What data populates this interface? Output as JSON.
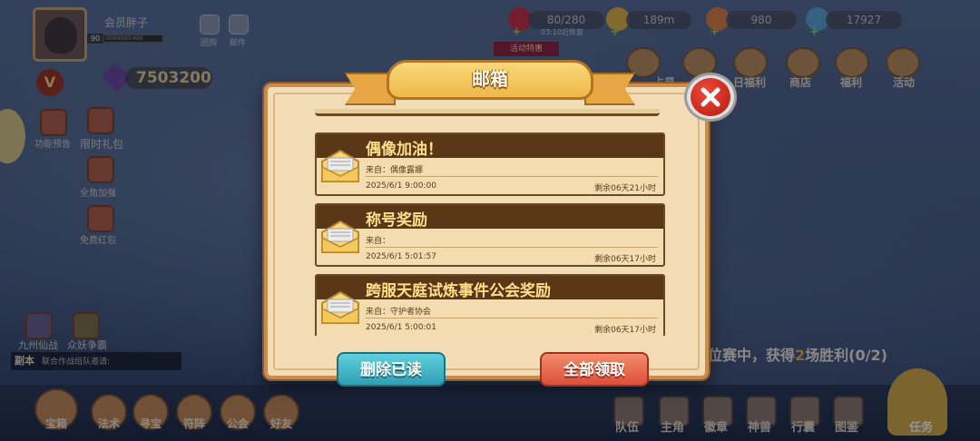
{
  "player": {
    "name": "会员胖子",
    "level": "90",
    "exp": "00000/01400"
  },
  "top_left_icons": [
    {
      "label": "团购"
    },
    {
      "label": "邮件"
    }
  ],
  "vip_badge": "V",
  "diamonds": "7503200",
  "resources": {
    "stamina": "80/280",
    "stamina_timer": "03:10后恢复",
    "gold": "189m",
    "gems": "980",
    "tickets": "17927"
  },
  "top_menu": [
    "占星",
    "神",
    "日福利",
    "商店",
    "福利",
    "活动"
  ],
  "top_menu_banner": "活动特惠",
  "left_menu": [
    {
      "label": "功能预告"
    },
    {
      "label": "限时礼包"
    },
    {
      "label": "全角加强"
    },
    {
      "label": "免费红包"
    }
  ],
  "bottom_left_events": [
    "九州仙战",
    "众妖争霸"
  ],
  "chat": {
    "channel": "副本",
    "text": "联合作战组队邀请:"
  },
  "quest_text_prefix": "位赛中，获得",
  "quest_text_highlight": "2",
  "quest_text_suffix": "场胜利(0/2)",
  "bottom_left_nav": [
    "宝箱",
    "法术",
    "寻宝",
    "符阵",
    "公会",
    "好友"
  ],
  "bottom_right_nav": [
    "队伍",
    "主角",
    "徽章",
    "神兽",
    "行囊",
    "图鉴"
  ],
  "task_label": "任务",
  "mailbox": {
    "title": "邮箱",
    "mails": [
      {
        "title": "偶像加油！",
        "sender": "来自：偶像露娜",
        "date": "2025/6/1 9:00:00",
        "remaining": "剩余06天21小时"
      },
      {
        "title": "称号奖励",
        "sender": "来自：",
        "date": "2025/6/1 5:01:57",
        "remaining": "剩余06天17小时"
      },
      {
        "title": "跨服天庭试炼事件公会奖励",
        "sender": "来自：守护者协会",
        "date": "2025/6/1 5:00:01",
        "remaining": "剩余06天17小时"
      }
    ],
    "delete_read_label": "删除已读",
    "claim_all_label": "全部领取"
  },
  "colors": {
    "modal_bg": "#f1dcb6",
    "mail_header": "#5a3817",
    "mail_title": "#ffe08a",
    "delete_btn": "#2f9fb3",
    "claim_btn": "#db4f3a",
    "close_btn": "#d0281c"
  }
}
